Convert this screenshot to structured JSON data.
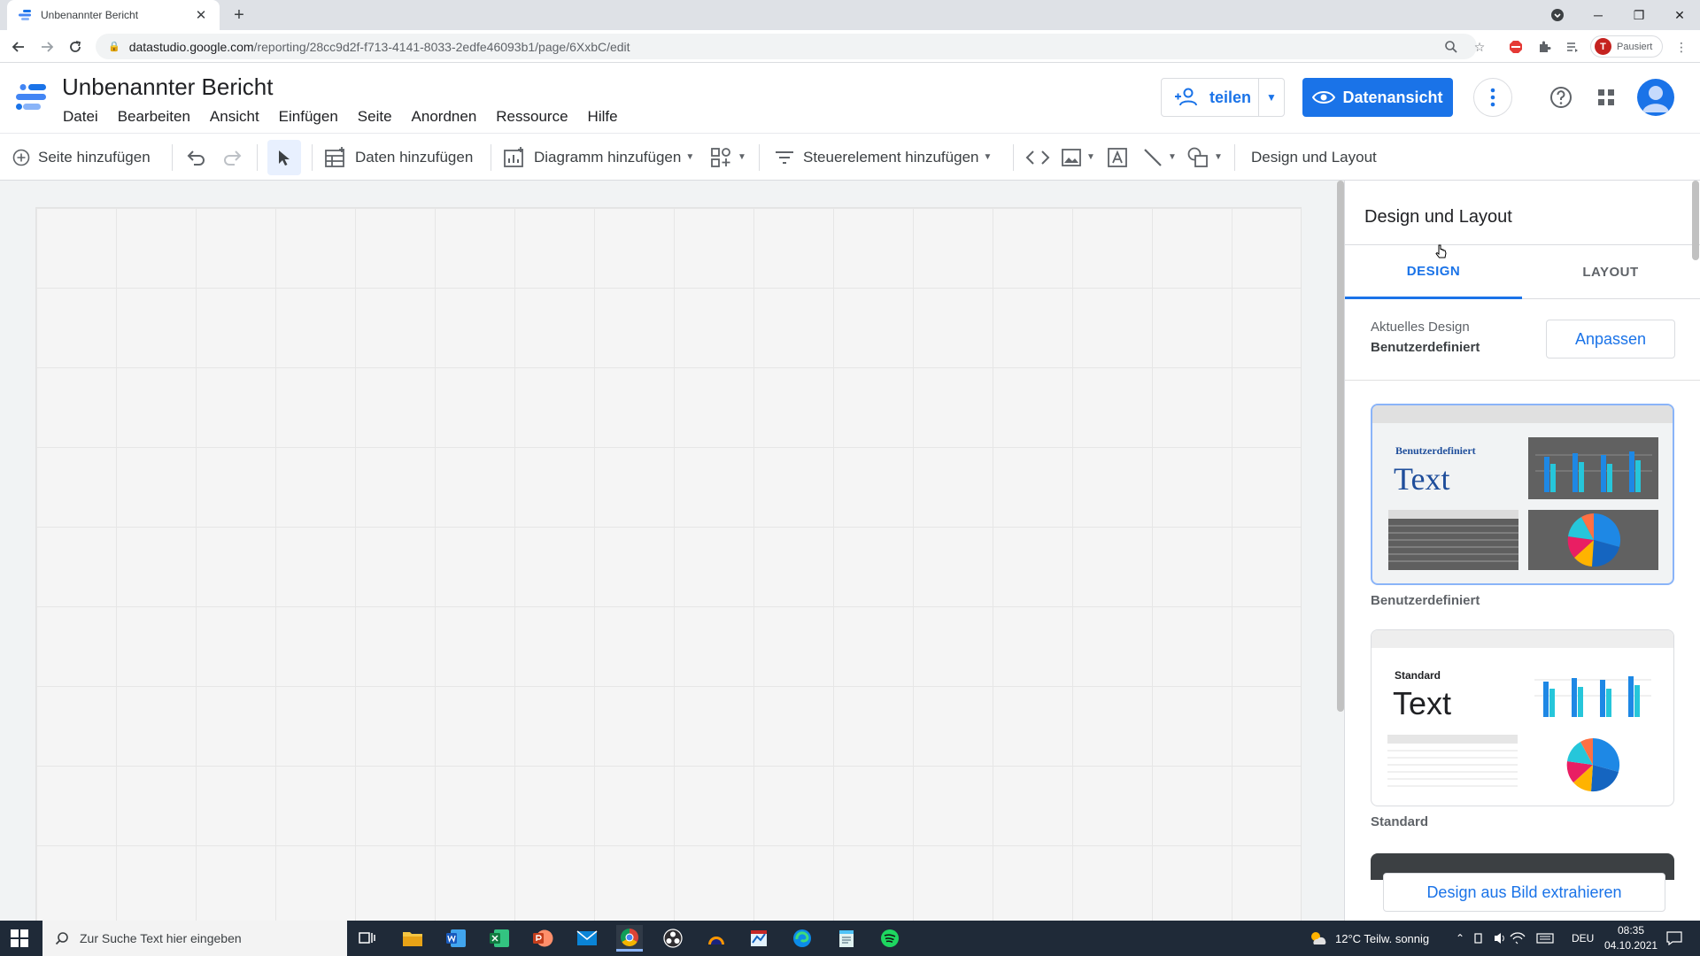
{
  "browser": {
    "tab_title": "Unbenannter Bericht",
    "url_host": "datastudio.google.com",
    "url_path": "/reporting/28cc9d2f-f713-4141-8033-2edfe46093b1/page/6XxbC/edit",
    "profile_initial": "T",
    "profile_label": "Pausiert"
  },
  "app": {
    "title": "Unbenannter Bericht",
    "menu": [
      "Datei",
      "Bearbeiten",
      "Ansicht",
      "Einfügen",
      "Seite",
      "Anordnen",
      "Ressource",
      "Hilfe"
    ],
    "share_label": "teilen",
    "view_label": "Datenansicht"
  },
  "toolbar": {
    "add_page": "Seite hinzufügen",
    "add_data": "Daten hinzufügen",
    "add_chart": "Diagramm hinzufügen",
    "add_control": "Steuerelement hinzufügen",
    "design_layout": "Design und Layout"
  },
  "panel": {
    "title": "Design und Layout",
    "tabs": [
      "DESIGN",
      "LAYOUT"
    ],
    "active_tab": "DESIGN",
    "current_label": "Aktuelles Design",
    "current_value": "Benutzerdefiniert",
    "customize_label": "Anpassen",
    "themes": [
      {
        "name": "Benutzerdefiniert",
        "preview_small": "Benutzerdefiniert",
        "preview_big": "Text",
        "selected": true
      },
      {
        "name": "Standard",
        "preview_small": "Standard",
        "preview_big": "Text",
        "selected": false
      }
    ],
    "extract_label": "Design aus Bild extrahieren"
  },
  "taskbar": {
    "search_placeholder": "Zur Suche Text hier eingeben",
    "weather": "12°C  Teilw. sonnig",
    "language": "DEU",
    "time": "08:35",
    "date": "04.10.2021"
  },
  "colors": {
    "accent": "#1a73e8",
    "custom_theme_text": "#1f4e9b",
    "taskbar": "#1f2a38"
  }
}
